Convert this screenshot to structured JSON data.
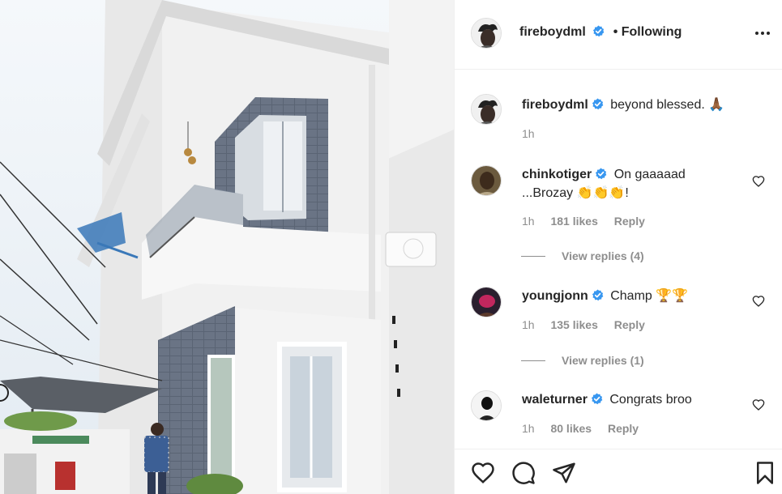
{
  "post": {
    "author": "fireboydml",
    "following_label": "• Following",
    "caption": "beyond blessed. 🙏🏾",
    "caption_time": "1h"
  },
  "comments": [
    {
      "user": "chinkotiger",
      "text_line1": "On gaaaaad",
      "text_line2": "...Brozay 👏👏👏!",
      "time": "1h",
      "likes": "181 likes",
      "reply": "Reply",
      "view_replies": "View replies (4)"
    },
    {
      "user": "youngjonn",
      "text_line1": "Champ 🏆🏆",
      "time": "1h",
      "likes": "135 likes",
      "reply": "Reply",
      "view_replies": "View replies (1)"
    },
    {
      "user": "waleturner",
      "text_line1": "Congrats broo",
      "time": "1h",
      "likes": "80 likes",
      "reply": "Reply"
    }
  ],
  "colors": {
    "verified_blue": "#3897f0",
    "text": "#262626",
    "muted": "#8e8e8e",
    "border": "#efefef"
  },
  "icons": {
    "verified": "verified-badge-icon",
    "more": "more-options-icon",
    "like": "heart-icon",
    "comment": "comment-bubble-icon",
    "share": "paper-plane-icon",
    "save": "bookmark-icon"
  }
}
